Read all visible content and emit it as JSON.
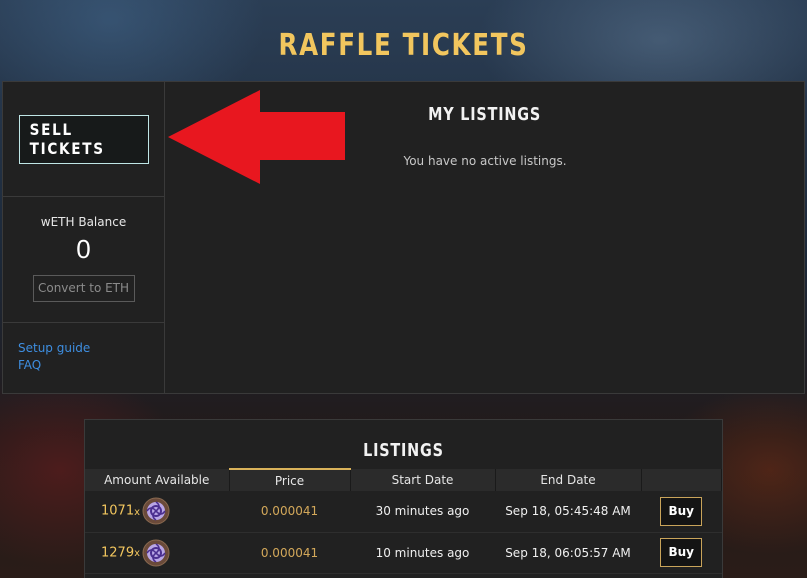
{
  "page": {
    "title": "RAFFLE TICKETS"
  },
  "sidebar": {
    "sell_button": "SELL TICKETS",
    "balance_label": "wETH Balance",
    "balance_value": "0",
    "convert_button": "Convert to ETH",
    "links": [
      "Setup guide",
      "FAQ"
    ]
  },
  "my_listings": {
    "title": "MY LISTINGS",
    "empty_message": "You have no active listings."
  },
  "listings": {
    "title": "LISTINGS",
    "columns": [
      "Amount Available",
      "Price",
      "Start Date",
      "End Date",
      ""
    ],
    "active_column": "Price",
    "rows": [
      {
        "amount": "1071",
        "multiplier": "x",
        "icon": "raffle-ticket-icon",
        "price": "0.000041",
        "start": "30 minutes ago",
        "end": "Sep 18, 05:45:48 AM",
        "action": "Buy"
      },
      {
        "amount": "1279",
        "multiplier": "x",
        "icon": "raffle-ticket-icon",
        "price": "0.000041",
        "start": "10 minutes ago",
        "end": "Sep 18, 06:05:57 AM",
        "action": "Buy"
      }
    ]
  },
  "colors": {
    "accent_gold": "#f2c65e",
    "annotation_arrow": "#e8171f",
    "link_blue": "#3e8ee0"
  }
}
